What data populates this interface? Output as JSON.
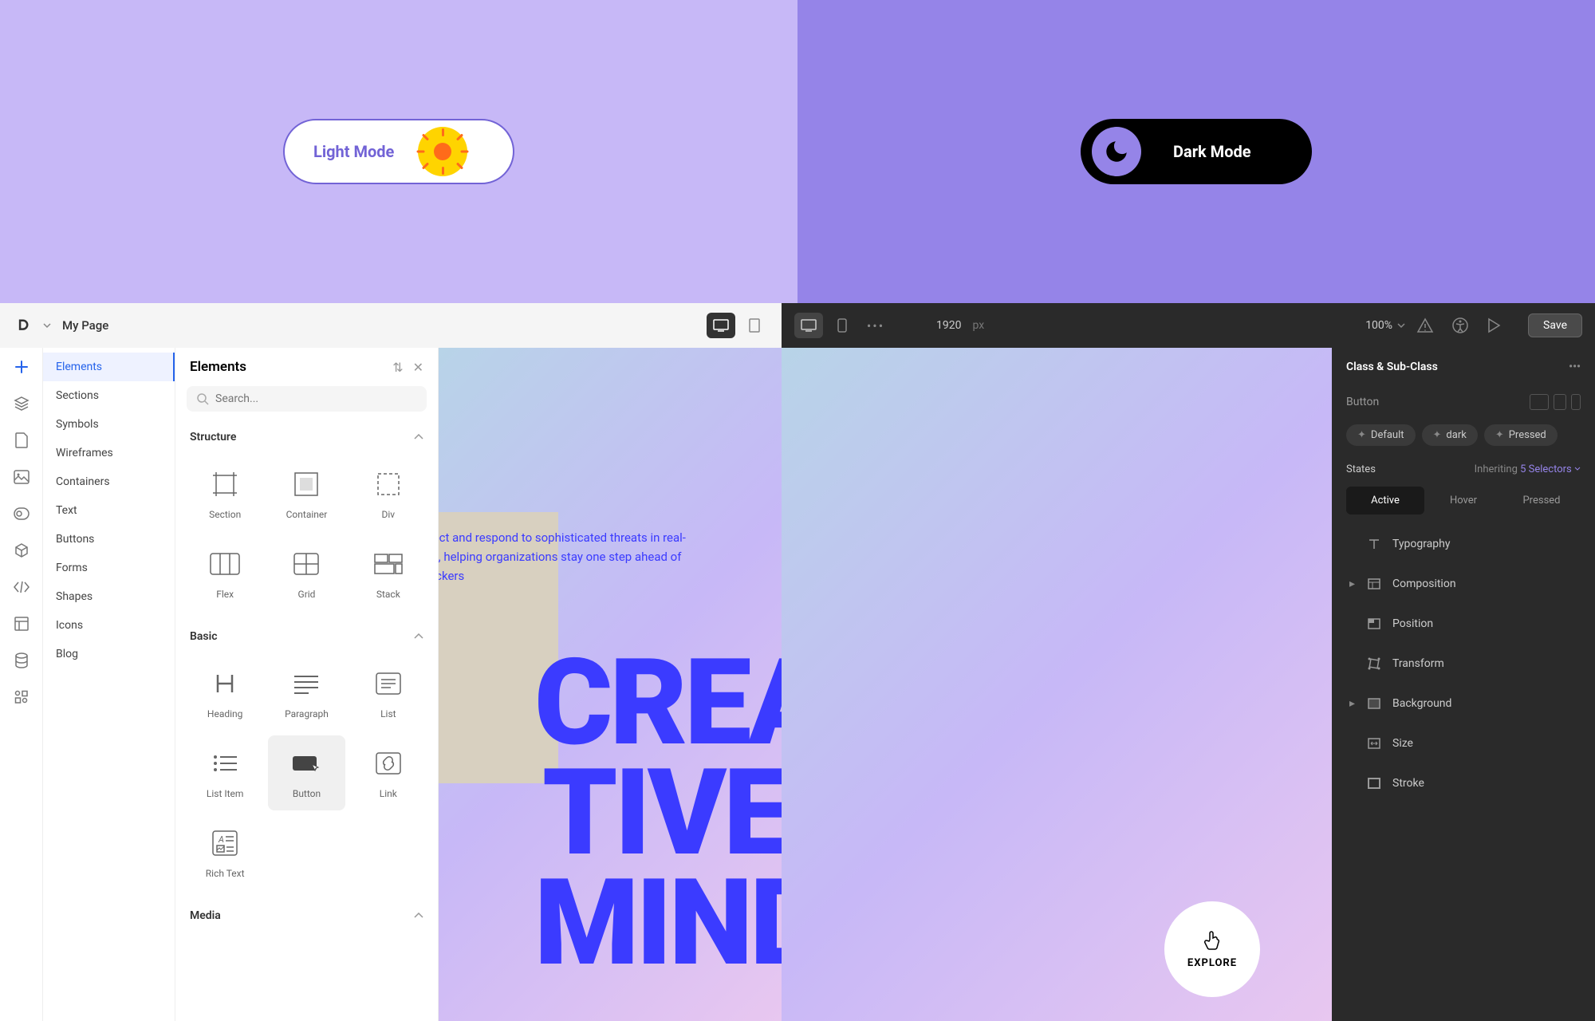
{
  "banner": {
    "light_label": "Light Mode",
    "dark_label": "Dark Mode"
  },
  "topbar": {
    "page_title": "My Page",
    "zoom": "100%",
    "save": "Save",
    "canvas_width": "1920",
    "canvas_unit": "px"
  },
  "sidebar_nav": {
    "items": [
      "Elements",
      "Sections",
      "Symbols",
      "Wireframes",
      "Containers",
      "Text",
      "Buttons",
      "Forms",
      "Shapes",
      "Icons",
      "Blog"
    ]
  },
  "elements_panel": {
    "title": "Elements",
    "search_placeholder": "Search...",
    "sections": {
      "structure": {
        "title": "Structure",
        "items": [
          "Section",
          "Container",
          "Div",
          "Flex",
          "Grid",
          "Stack"
        ]
      },
      "basic": {
        "title": "Basic",
        "items": [
          "Heading",
          "Paragraph",
          "List",
          "List Item",
          "Button",
          "Link",
          "Rich Text"
        ]
      },
      "media": {
        "title": "Media"
      }
    }
  },
  "canvas": {
    "tagline": "Detect and respond to sophisticated threats in real-time, helping organizations stay one step ahead of attackers",
    "hero_line1": "CREA",
    "hero_line2": "TIVE",
    "hero_line3": "MIND",
    "explore": "EXPLORE"
  },
  "right_panel": {
    "header": "Class & Sub-Class",
    "element_label": "Button",
    "chips": [
      "Default",
      "dark",
      "Pressed"
    ],
    "states_label": "States",
    "inherit_prefix": "Inheriting ",
    "inherit_link": "5 Selectors",
    "state_tabs": [
      "Active",
      "Hover",
      "Pressed"
    ],
    "properties": [
      "Typography",
      "Composition",
      "Position",
      "Transform",
      "Background",
      "Size",
      "Stroke"
    ]
  }
}
